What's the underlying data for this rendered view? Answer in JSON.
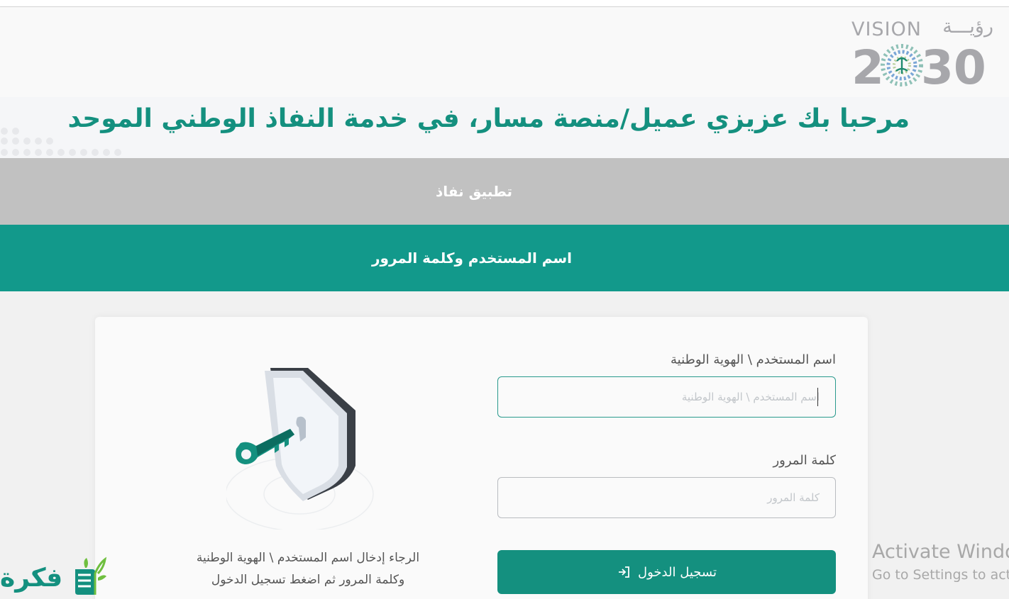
{
  "header": {
    "logo": {
      "word": "VISION",
      "arabic": "رؤيـــة",
      "year_left": "2",
      "year_right": "30"
    }
  },
  "welcome": {
    "title": "مرحبا بك عزيزي عميل/منصة مسار، في خدمة النفاذ الوطني الموحد"
  },
  "tabs": {
    "nafath_app": "تطبيق نفاذ",
    "username_password": "اسم المستخدم وكلمة المرور"
  },
  "form": {
    "username_label": "اسم المستخدم \\ الهوية الوطنية",
    "username_placeholder": "اسم المستخدم \\ الهوية الوطنية",
    "username_value": "",
    "password_label": "كلمة المرور",
    "password_placeholder": "كلمة المرور",
    "password_value": "",
    "login_button": "تسجيل الدخول"
  },
  "help": {
    "line1": "الرجاء إدخال اسم المستخدم \\ الهوية الوطنية",
    "line2": "وكلمة المرور ثم اضغط تسجيل الدخول"
  },
  "os_overlay": {
    "activate_title": "Activate Windows",
    "activate_sub": "Go to Settings to activate Windows."
  },
  "watermark": {
    "text": "فكرة"
  },
  "colors": {
    "accent": "#14907f",
    "tab_active": "#12998b",
    "tab_inactive": "#c1c1c1"
  }
}
